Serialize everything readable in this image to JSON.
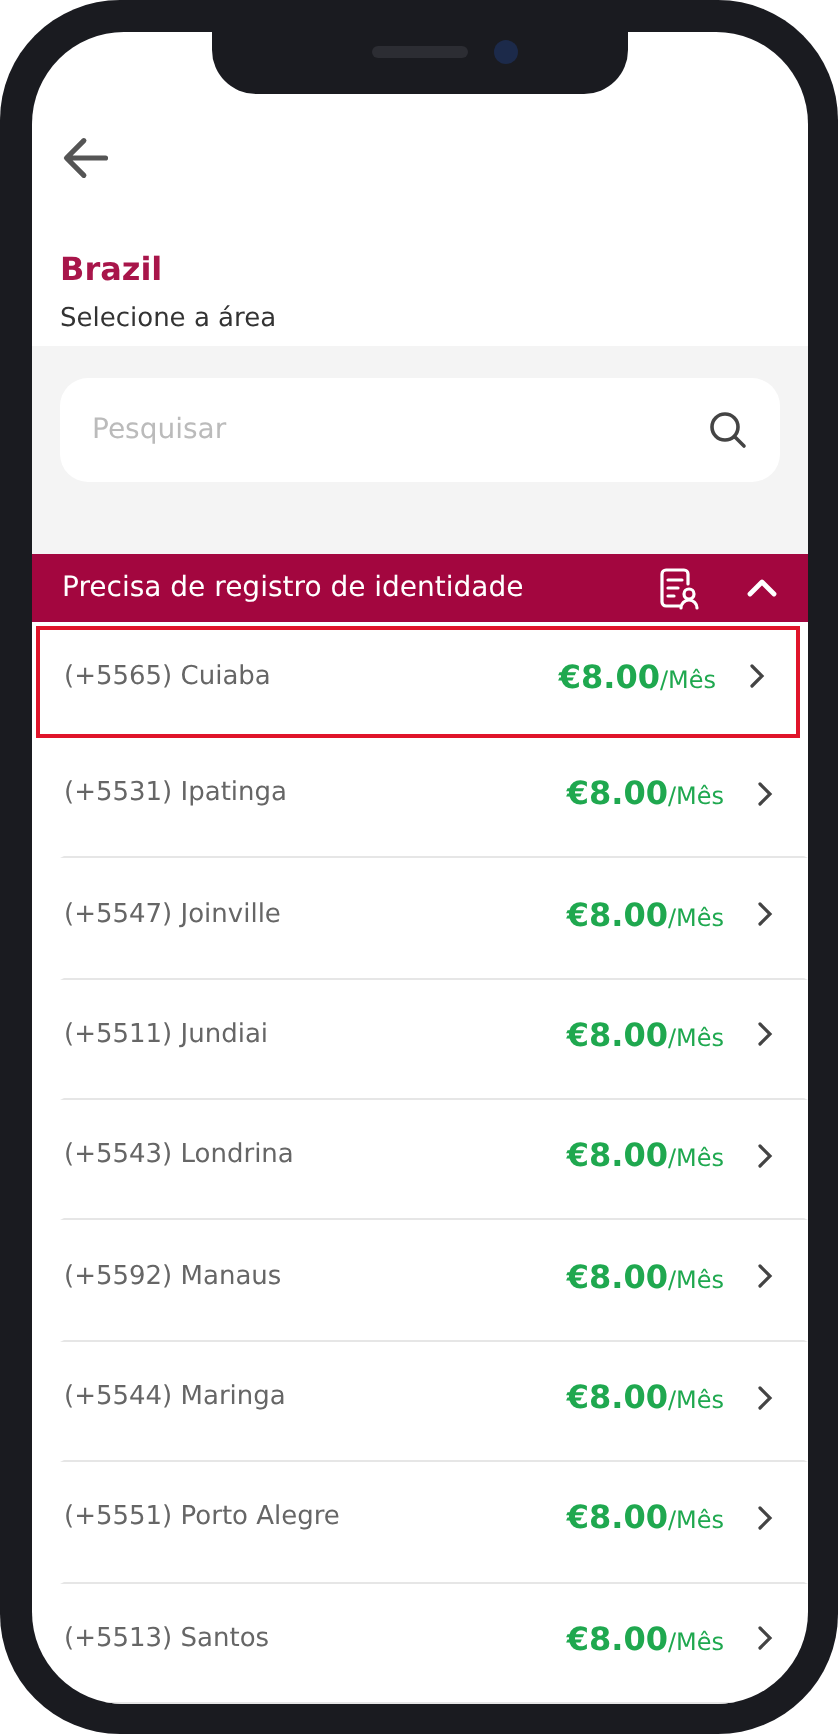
{
  "header": {
    "title": "Brazil",
    "subtitle": "Selecione a área"
  },
  "search": {
    "placeholder": "Pesquisar"
  },
  "section": {
    "title": "Precisa de registro de identidade",
    "expanded": true
  },
  "rows": [
    {
      "code": "(+5565)",
      "city": "Cuiaba",
      "price": "€8.00",
      "period": "/Mês",
      "selected": true
    },
    {
      "code": "(+5531)",
      "city": "Ipatinga",
      "price": "€8.00",
      "period": "/Mês",
      "selected": false
    },
    {
      "code": "(+5547)",
      "city": "Joinville",
      "price": "€8.00",
      "period": "/Mês",
      "selected": false
    },
    {
      "code": "(+5511)",
      "city": "Jundiai",
      "price": "€8.00",
      "period": "/Mês",
      "selected": false
    },
    {
      "code": "(+5543)",
      "city": "Londrina",
      "price": "€8.00",
      "period": "/Mês",
      "selected": false
    },
    {
      "code": "(+5592)",
      "city": "Manaus",
      "price": "€8.00",
      "period": "/Mês",
      "selected": false
    },
    {
      "code": "(+5544)",
      "city": "Maringa",
      "price": "€8.00",
      "period": "/Mês",
      "selected": false
    },
    {
      "code": "(+5551)",
      "city": "Porto Alegre",
      "price": "€8.00",
      "period": "/Mês",
      "selected": false
    },
    {
      "code": "(+5513)",
      "city": "Santos",
      "price": "€8.00",
      "period": "/Mês",
      "selected": false
    }
  ]
}
